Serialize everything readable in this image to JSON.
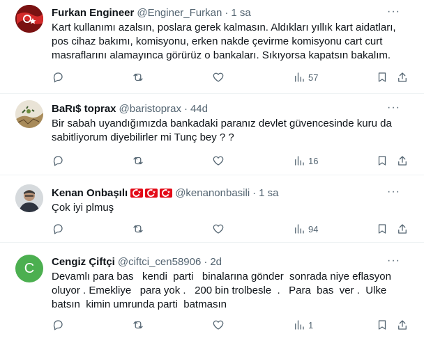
{
  "tweets": [
    {
      "name": "Furkan Engineer",
      "handle": "@Enginer_Furkan",
      "time": "1 sa",
      "text": "Kart kullanımı azalsın, poslara gerek kalmasın. Aldıkları yıllık kart aidatları, pos cihaz bakımı, komisyonu, erken nakde çevirme komisyonu cart curt masraflarını alamayınca görürüz o bankaları. Sıkıyorsa kapatsın bakalım.",
      "views": "57",
      "avatar": "flag-avatar"
    },
    {
      "name": "BaRı$ toprax",
      "handle": "@baristoprax",
      "time": "44d",
      "text": "Bir sabah uyandığımızda bankadaki paranız devlet güvencesinde kuru da sabitliyorum diyebilirler mi Tunç bey ? ?",
      "views": "16",
      "avatar": "cracked-ground-avatar"
    },
    {
      "name": "Kenan Onbaşılı",
      "handle": "@kenanonbasili",
      "time": "1 sa",
      "text": "Çok iyi plmuş",
      "views": "94",
      "avatar": "photo-avatar"
    },
    {
      "name": "Cengiz Çiftçi",
      "handle": "@ciftci_cen58906",
      "time": "2d",
      "text": "Devamlı para bas   kendi  parti   binalarına gönder  sonrada niye eflasyon oluyor . Emekliye   para yok .   200 bin trolbesle  .   Para  bas  ver .  Ulke batsın  kimin umrunda parti  batmasın",
      "views": "1",
      "avatar_letter": "C"
    }
  ],
  "more_label": "···",
  "dot": "·"
}
